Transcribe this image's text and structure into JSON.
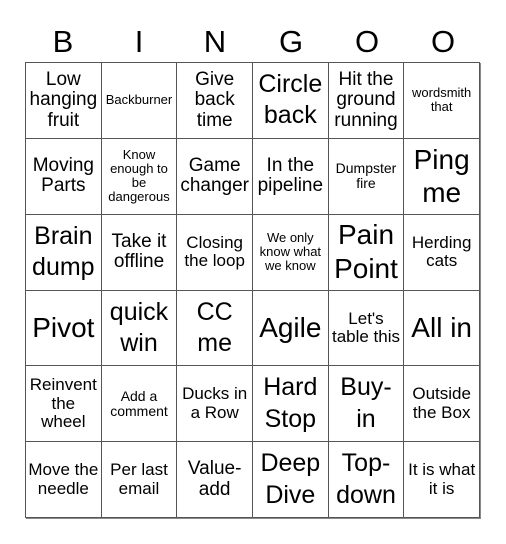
{
  "header": {
    "letters": [
      "B",
      "I",
      "N",
      "G",
      "O",
      "O"
    ]
  },
  "cells": [
    "Low hanging fruit",
    "Backburner",
    "Give back time",
    "Circle back",
    "Hit the ground running",
    "wordsmith that",
    "Moving Parts",
    "Know enough to be dangerous",
    "Game changer",
    "In the pipeline",
    "Dumpster fire",
    "Ping me",
    "Brain dump",
    "Take it offline",
    "Closing the loop",
    "We only know what we know",
    "Pain Point",
    "Herding cats",
    "Pivot",
    "quick win",
    "CC me",
    "Agile",
    "Let's table this",
    "All in",
    "Reinvent the wheel",
    "Add a comment",
    "Ducks in a Row",
    "Hard Stop",
    "Buy-in",
    "Outside the Box",
    "Move the needle",
    "Per last email",
    "Value-add",
    "Deep Dive",
    "Top-down",
    "It is what it is"
  ]
}
